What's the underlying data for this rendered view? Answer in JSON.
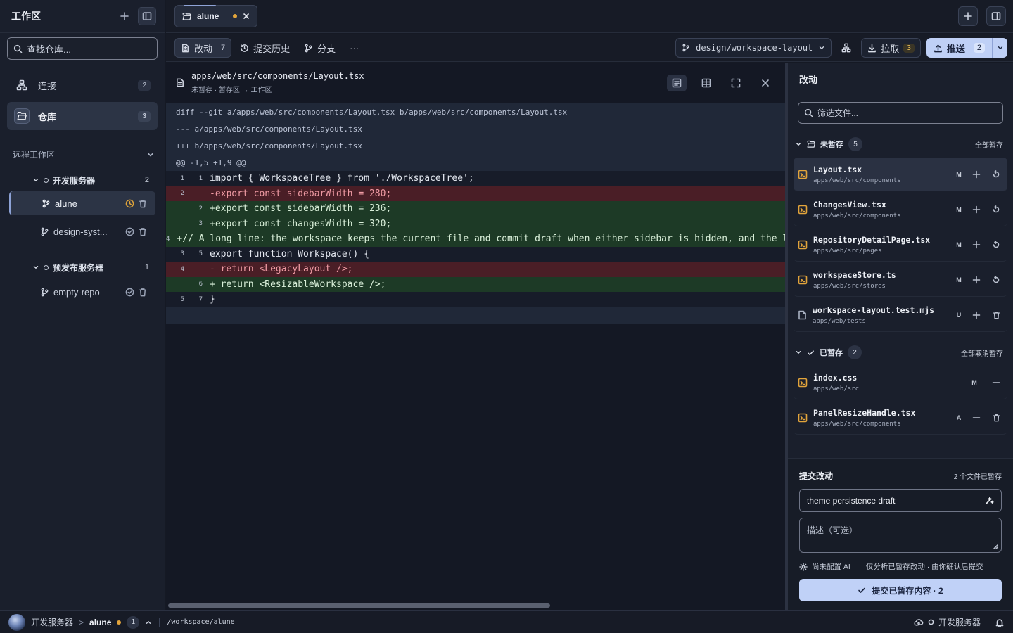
{
  "sidebar": {
    "title": "工作区",
    "search_placeholder": "查找仓库...",
    "nav": [
      {
        "label": "连接",
        "count": "2",
        "icon": "network-icon"
      },
      {
        "label": "仓库",
        "count": "3",
        "icon": "folder-open-icon"
      }
    ],
    "remote_title": "远程工作区",
    "servers": [
      {
        "name": "开发服务器",
        "count": "2",
        "repos": [
          "alune",
          "design-syst..."
        ]
      },
      {
        "name": "预发布服务器",
        "count": "1",
        "repos": [
          "empty-repo"
        ]
      }
    ]
  },
  "tabbar": {
    "tab_label": "alune"
  },
  "toolbar": {
    "changes_label": "改动",
    "changes_count": "7",
    "history_label": "提交历史",
    "branch_label": "分支",
    "more_label": "···",
    "branch_name": "design/workspace-layout",
    "pull_label": "拉取",
    "pull_count": "3",
    "push_label": "推送",
    "push_count": "2"
  },
  "diff": {
    "file_path": "apps/web/src/components/Layout.tsx",
    "sub": "未暂存 · 暂存区 → 工作区",
    "meta": [
      "diff --git a/apps/web/src/components/Layout.tsx b/apps/web/src/components/Layout.tsx",
      "--- a/apps/web/src/components/Layout.tsx",
      "+++ b/apps/web/src/components/Layout.tsx",
      "@@ -1,5 +1,9 @@"
    ],
    "lines": [
      {
        "type": "ctx",
        "old": "1",
        "new": "1",
        "text": " import { WorkspaceTree } from './WorkspaceTree';"
      },
      {
        "type": "del",
        "old": "2",
        "new": "",
        "text": "-export const sidebarWidth = 280;"
      },
      {
        "type": "add",
        "old": "",
        "new": "2",
        "text": "+export const sidebarWidth = 236;"
      },
      {
        "type": "add",
        "old": "",
        "new": "3",
        "text": "+export const changesWidth = 320;"
      },
      {
        "type": "add",
        "old": "",
        "new": "4",
        "text": "+// A long line: the workspace keeps the current file and commit draft when either sidebar is hidden, and the layout restores widths."
      },
      {
        "type": "ctx",
        "old": "3",
        "new": "5",
        "text": " export function Workspace() {"
      },
      {
        "type": "del",
        "old": "4",
        "new": "",
        "text": "-   return <LegacyLayout />;"
      },
      {
        "type": "add",
        "old": "",
        "new": "6",
        "text": "+   return <ResizableWorkspace />;"
      },
      {
        "type": "ctx",
        "old": "5",
        "new": "7",
        "text": " }"
      }
    ]
  },
  "changes": {
    "title": "改动",
    "filter_placeholder": "筛选文件...",
    "unstaged": {
      "label": "未暂存",
      "count": "5",
      "action": "全部暂存",
      "files": [
        {
          "name": "Layout.tsx",
          "path": "apps/web/src/components",
          "status": "M",
          "icon": "code-file-icon"
        },
        {
          "name": "ChangesView.tsx",
          "path": "apps/web/src/components",
          "status": "M",
          "icon": "code-file-icon"
        },
        {
          "name": "RepositoryDetailPage.tsx",
          "path": "apps/web/src/pages",
          "status": "M",
          "icon": "code-file-icon"
        },
        {
          "name": "workspaceStore.ts",
          "path": "apps/web/src/stores",
          "status": "M",
          "icon": "code-file-icon"
        },
        {
          "name": "workspace-layout.test.mjs",
          "path": "apps/web/tests",
          "status": "U",
          "icon": "file-icon"
        }
      ]
    },
    "staged": {
      "label": "已暂存",
      "count": "2",
      "action": "全部取消暂存",
      "files": [
        {
          "name": "index.css",
          "path": "apps/web/src",
          "status": "M",
          "icon": "code-file-icon"
        },
        {
          "name": "PanelResizeHandle.tsx",
          "path": "apps/web/src/components",
          "status": "A",
          "icon": "code-file-icon"
        }
      ]
    },
    "commit": {
      "title": "提交改动",
      "staged_info": "2 个文件已暂存",
      "summary_value": "theme persistence draft",
      "desc_placeholder": "描述（可选）",
      "ai_status": "尚未配置 AI",
      "ai_hint": "仅分析已暂存改动 · 由你确认后提交",
      "button_label": "提交已暂存内容 · 2"
    }
  },
  "status": {
    "server": "开发服务器",
    "sep": ">",
    "repo": "alune",
    "count": "1",
    "path": "/workspace/alune",
    "right_server": "开发服务器"
  },
  "colors": {
    "accent": "#c0d1f7",
    "warning": "#e2a43b",
    "del_bg": "#4a1e26",
    "add_bg": "#1d3a26"
  }
}
